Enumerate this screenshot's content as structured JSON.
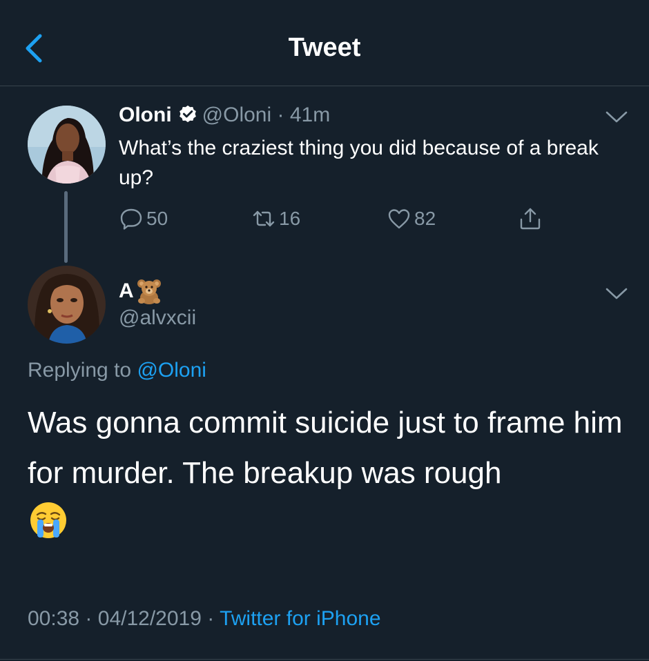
{
  "header": {
    "title": "Tweet"
  },
  "parent_tweet": {
    "name": "Oloni",
    "handle": "@Oloni",
    "separator": "·",
    "time": "41m",
    "text": "What’s the craziest thing you did because of a break up?",
    "actions": {
      "replies": "50",
      "retweets": "16",
      "likes": "82"
    }
  },
  "reply_tweet": {
    "name": "A",
    "handle": "@alvxcii",
    "replying_prefix": "Replying to",
    "replying_to": "@Oloni",
    "text": "Was gonna commit suicide just to frame him for murder. The breakup was rough",
    "time": "00:38",
    "date": "04/12/2019",
    "sep1": "·",
    "sep2": "·",
    "source": "Twitter for iPhone"
  },
  "colors": {
    "background": "#15202b",
    "accent": "#1da1f2",
    "secondary_text": "#8899a6",
    "divider": "#38444d"
  },
  "icons": [
    "back-arrow-icon",
    "verified-badge-icon",
    "chevron-down-icon",
    "reply-icon",
    "retweet-icon",
    "like-icon",
    "share-icon",
    "teddy-bear-emoji",
    "crying-face-emoji"
  ]
}
